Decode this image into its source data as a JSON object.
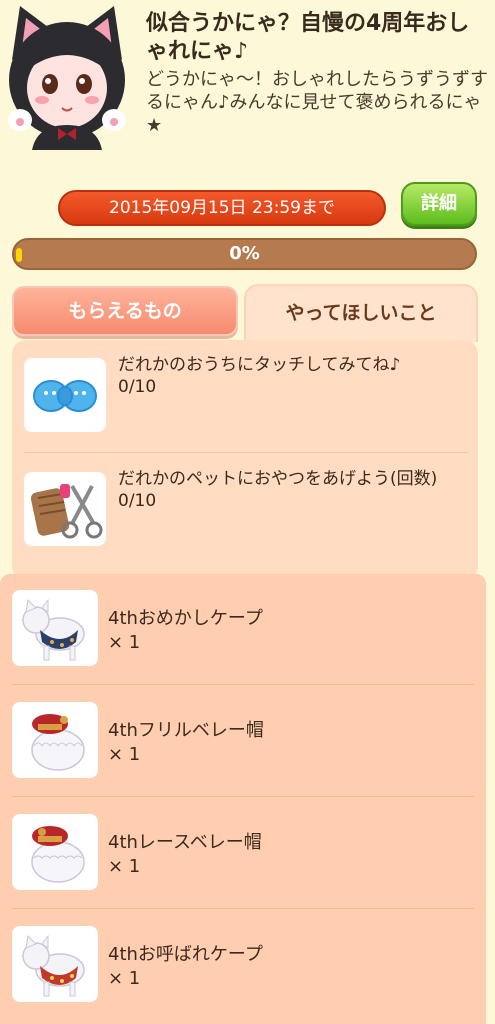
{
  "header": {
    "title": "似合うかにゃ？自慢の4周年おしゃれにゃ♪",
    "subtitle": "どうかにゃ〜！おしゃれしたらうずうずするにゃん♪みんなに見せて褒められるにゃ★"
  },
  "event": {
    "deadline": "2015年09月15日 23:59まで",
    "detail_label": "詳細",
    "progress_label": "0%",
    "progress_fraction": 0
  },
  "tabs": {
    "rewards_label": "もらえるもの",
    "tasks_label": "やってほしいこと"
  },
  "tasks": [
    {
      "text": "だれかのおうちにタッチしてみてね♪",
      "count": "0/10",
      "icon": "blue-bow-icon"
    },
    {
      "text": "だれかのペットにおやつをあげよう(回数)",
      "count": "0/10",
      "icon": "grooming-tools-icon"
    }
  ],
  "rewards": [
    {
      "name": "4thおめかしケープ",
      "qty": "× 1",
      "icon": "cat-cape-icon"
    },
    {
      "name": "4thフリルベレー帽",
      "qty": "× 1",
      "icon": "frill-beret-icon"
    },
    {
      "name": "4thレースベレー帽",
      "qty": "× 1",
      "icon": "lace-beret-icon"
    },
    {
      "name": "4thお呼ばれケープ",
      "qty": "× 1",
      "icon": "party-cape-icon"
    }
  ],
  "colors": {
    "background": "#fdf9d8",
    "deadline_pill": "#e84a1a",
    "detail_button": "#6cc624",
    "progress_track": "#b57a4e",
    "tasks_panel": "#ffdcc2",
    "rewards_panel": "#ffcdb0"
  }
}
